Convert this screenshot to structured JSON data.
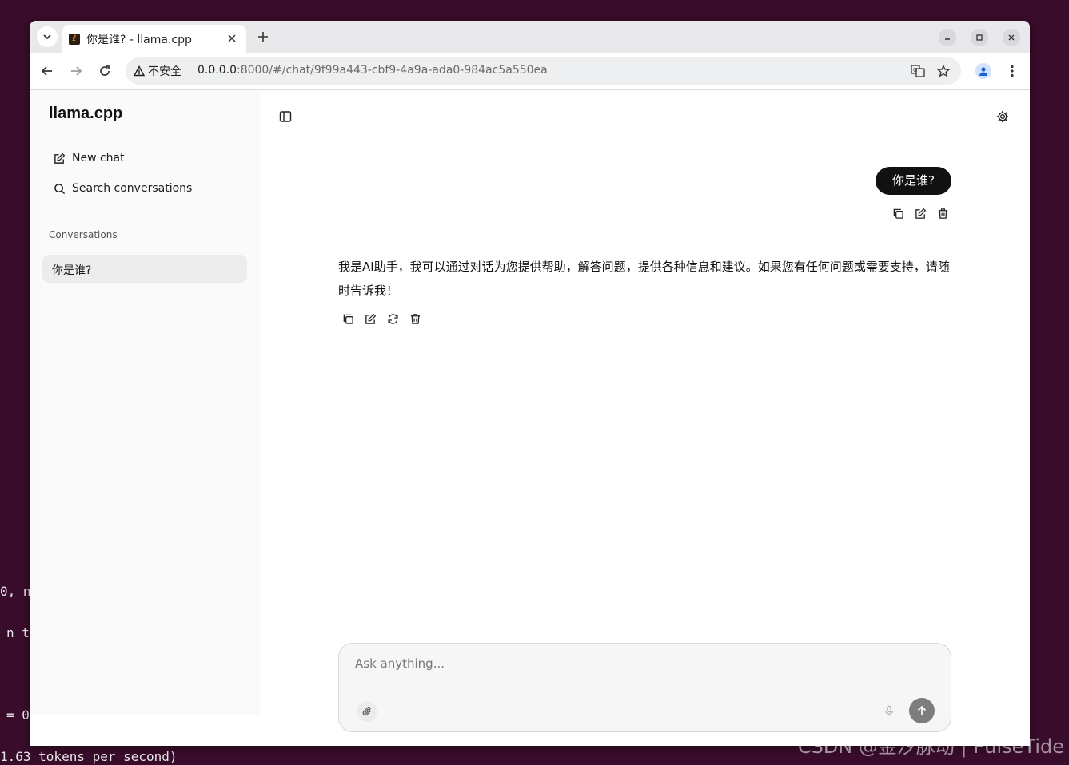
{
  "terminal": {
    "lines": [
      "0, n",
      "n_t",
      "= 0",
      "1.63 tokens per second)"
    ]
  },
  "browser": {
    "tab_title": "你是谁? - llama.cpp",
    "address": {
      "security_label": "不安全",
      "host": "0.0.0.0",
      "path": ":8000/#/chat/9f99a443-cbf9-4a9a-ada0-984ac5a550ea"
    }
  },
  "sidebar": {
    "brand": "llama.cpp",
    "new_chat_label": "New chat",
    "search_label": "Search conversations",
    "conversations_heading": "Conversations",
    "conversations": [
      {
        "title": "你是谁?"
      }
    ]
  },
  "chat": {
    "user_message": "你是谁?",
    "assistant_message": "我是AI助手，我可以通过对话为您提供帮助，解答问题，提供各种信息和建议。如果您有任何问题或需要支持，请随时告诉我！"
  },
  "composer": {
    "placeholder": "Ask anything..."
  },
  "watermark": "CSDN @金汐脉动 | PulseTide",
  "colors": {
    "desktop": "#380c2a",
    "user_bubble": "#111111",
    "send_button": "#7d7d7d"
  }
}
